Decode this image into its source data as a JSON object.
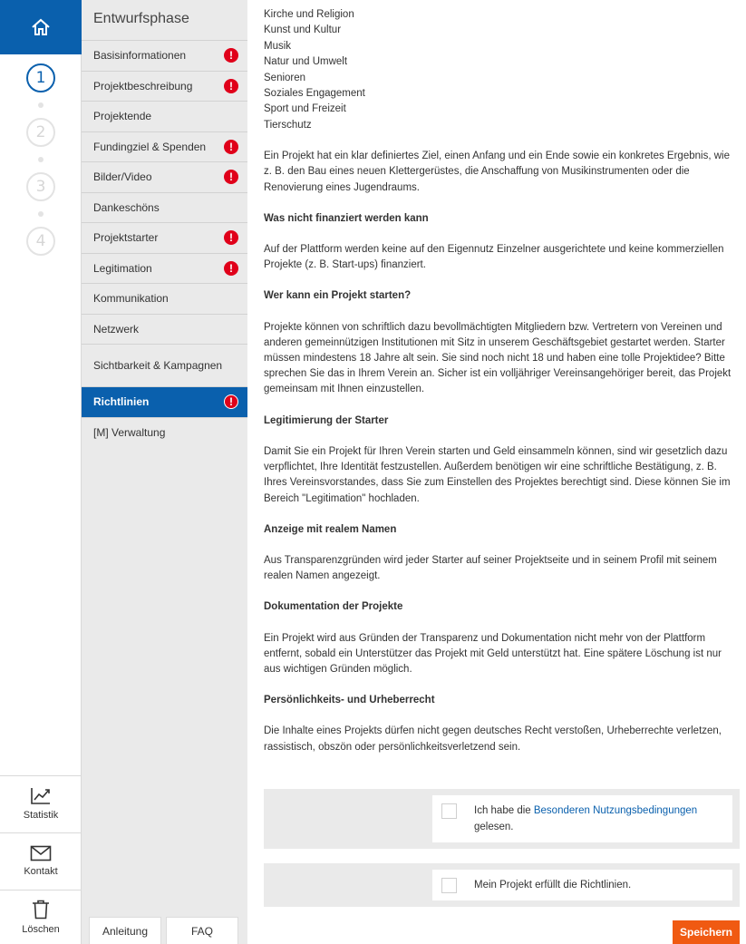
{
  "rail": {
    "steps": [
      "1",
      "2",
      "3",
      "4"
    ],
    "statistik": "Statistik",
    "kontakt": "Kontakt",
    "loeschen": "Löschen"
  },
  "menu": {
    "title": "Entwurfsphase",
    "items": [
      {
        "label": "Basisinformationen",
        "warning": true
      },
      {
        "label": "Projektbeschreibung",
        "warning": true
      },
      {
        "label": "Projektende",
        "warning": false
      },
      {
        "label": "Fundingziel & Spenden",
        "warning": true
      },
      {
        "label": "Bilder/Video",
        "warning": true
      },
      {
        "label": "Dankeschöns",
        "warning": false
      },
      {
        "label": "Projektstarter",
        "warning": true
      },
      {
        "label": "Legitimation",
        "warning": true
      },
      {
        "label": "Kommunikation",
        "warning": false
      },
      {
        "label": "Netzwerk",
        "warning": false
      },
      {
        "label": "Sichtbarkeit & Kampagnen",
        "warning": false
      },
      {
        "label": "Richtlinien",
        "warning": true
      },
      {
        "label": "[M] Verwaltung",
        "warning": false
      }
    ],
    "warning_glyph": "!",
    "anleitung": "Anleitung",
    "faq": "FAQ"
  },
  "content": {
    "categories": [
      "Kirche und Religion",
      "Kunst und Kultur",
      "Musik",
      "Natur und Umwelt",
      "Senioren",
      "Soziales Engagement",
      "Sport und Freizeit",
      "Tierschutz"
    ],
    "intro": "Ein Projekt hat ein klar definiertes Ziel, einen Anfang und ein Ende sowie ein konkretes Ergebnis, wie z. B. den Bau eines neuen Klettergerüstes, die Anschaffung von Musikinstrumenten oder die Renovierung eines Jugendraums.",
    "sections": [
      {
        "heading": "Was nicht finanziert werden kann",
        "text": "Auf der Plattform werden keine auf den Eigennutz Einzelner ausgerichtete und keine kommerziellen Projekte (z. B. Start-ups) finanziert."
      },
      {
        "heading": "Wer kann ein Projekt starten?",
        "text": "Projekte können von schriftlich dazu bevollmächtigten Mitgliedern bzw. Vertretern von Vereinen und anderen gemeinnützigen Institutionen mit Sitz in unserem Geschäftsgebiet gestartet werden. Starter müssen mindestens 18 Jahre alt sein. Sie sind noch nicht 18 und haben eine tolle Projektidee? Bitte sprechen Sie das in Ihrem Verein an. Sicher ist ein volljähriger Vereinsangehöriger bereit, das Projekt gemeinsam mit Ihnen einzustellen."
      },
      {
        "heading": "Legitimierung der Starter",
        "text": "Damit Sie ein Projekt für Ihren Verein starten und Geld einsammeln können, sind wir gesetzlich dazu verpflichtet, Ihre Identität festzustellen. Außerdem benötigen wir eine schriftliche Bestätigung, z. B. Ihres Vereinsvorstandes, dass Sie zum Einstellen des Projektes berechtigt sind. Diese können Sie im Bereich \"Legitimation\" hochladen."
      },
      {
        "heading": "Anzeige mit realem Namen",
        "text": "Aus Transparenzgründen wird jeder Starter auf seiner Projektseite und in seinem Profil mit seinem realen Namen angezeigt."
      },
      {
        "heading": "Dokumentation der Projekte",
        "text": "Ein Projekt wird aus Gründen der Transparenz und Dokumentation nicht mehr von der Plattform entfernt, sobald ein Unterstützer das Projekt mit Geld unterstützt hat. Eine spätere Löschung ist nur aus wichtigen Gründen möglich."
      },
      {
        "heading": "Persönlichkeits- und Urheberrecht",
        "text": "Die Inhalte eines Projekts dürfen nicht gegen deutsches Recht verstoßen, Urheberrechte verletzen, rassistisch, obszön oder persönlichkeitsverletzend sein."
      }
    ]
  },
  "checks": {
    "terms_prefix": "Ich habe die ",
    "terms_link": "Besonderen Nutzungsbedingungen",
    "terms_suffix": "gelesen.",
    "guidelines": "Mein Projekt erfüllt die Richtlinien."
  },
  "save_label": "Speichern",
  "colors": {
    "primary": "#0a60ad",
    "warning": "#e0001a",
    "save": "#f05a12",
    "menu_bg": "#eaeaea"
  }
}
